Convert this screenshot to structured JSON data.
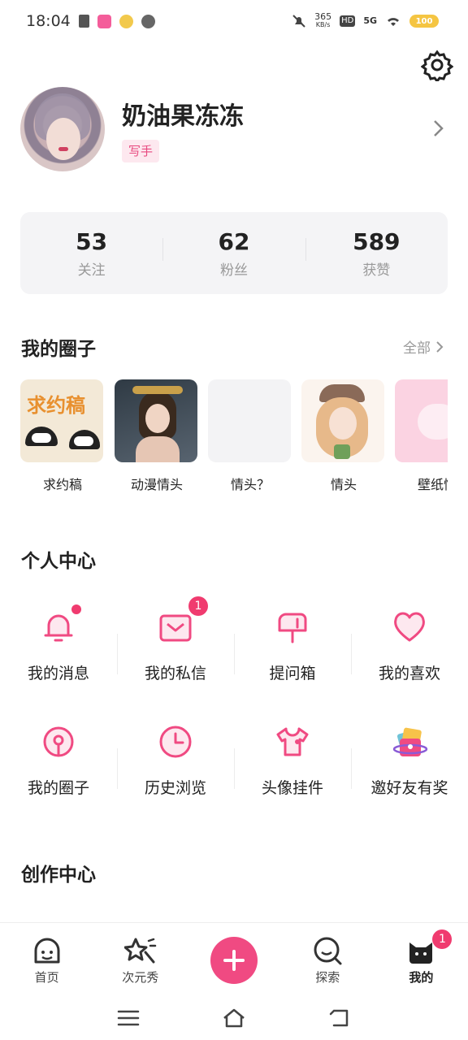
{
  "status_bar": {
    "time": "18:04",
    "net_speed_top": "365",
    "net_speed_bottom": "KB/s",
    "hd": "HD",
    "signal": "5G",
    "battery": "100"
  },
  "profile": {
    "username": "奶油果冻冻",
    "role": "写手"
  },
  "stats": [
    {
      "value": "53",
      "label": "关注"
    },
    {
      "value": "62",
      "label": "粉丝"
    },
    {
      "value": "589",
      "label": "获赞"
    }
  ],
  "circles_section": {
    "title": "我的圈子",
    "see_all": "全部"
  },
  "circles": [
    {
      "label": "求约稿",
      "thumb_text": "求约稿"
    },
    {
      "label": "动漫情头"
    },
    {
      "label": "情头？"
    },
    {
      "label": "情头"
    },
    {
      "label": "壁纸情"
    }
  ],
  "personal_center": {
    "title": "个人中心",
    "items": [
      {
        "label": "我的消息",
        "icon": "bell-icon"
      },
      {
        "label": "我的私信",
        "icon": "mail-icon",
        "badge": "1"
      },
      {
        "label": "提问箱",
        "icon": "mailbox-icon"
      },
      {
        "label": "我的喜欢",
        "icon": "heart-icon"
      },
      {
        "label": "我的圈子",
        "icon": "circle-icon"
      },
      {
        "label": "历史浏览",
        "icon": "clock-icon"
      },
      {
        "label": "头像挂件",
        "icon": "shirt-icon"
      },
      {
        "label": "邀好友有奖",
        "icon": "gift-icon"
      }
    ]
  },
  "creator_center": {
    "title": "创作中心"
  },
  "tabbar": [
    {
      "label": "首页",
      "icon": "home-face-icon"
    },
    {
      "label": "次元秀",
      "icon": "star-wand-icon"
    },
    {
      "label": "",
      "icon": "plus-icon"
    },
    {
      "label": "探索",
      "icon": "explore-icon"
    },
    {
      "label": "我的",
      "icon": "me-icon",
      "badge": "1"
    }
  ],
  "colors": {
    "accent": "#f04a82",
    "badge": "#f03b6f",
    "stats_bg": "#f4f4f6"
  }
}
